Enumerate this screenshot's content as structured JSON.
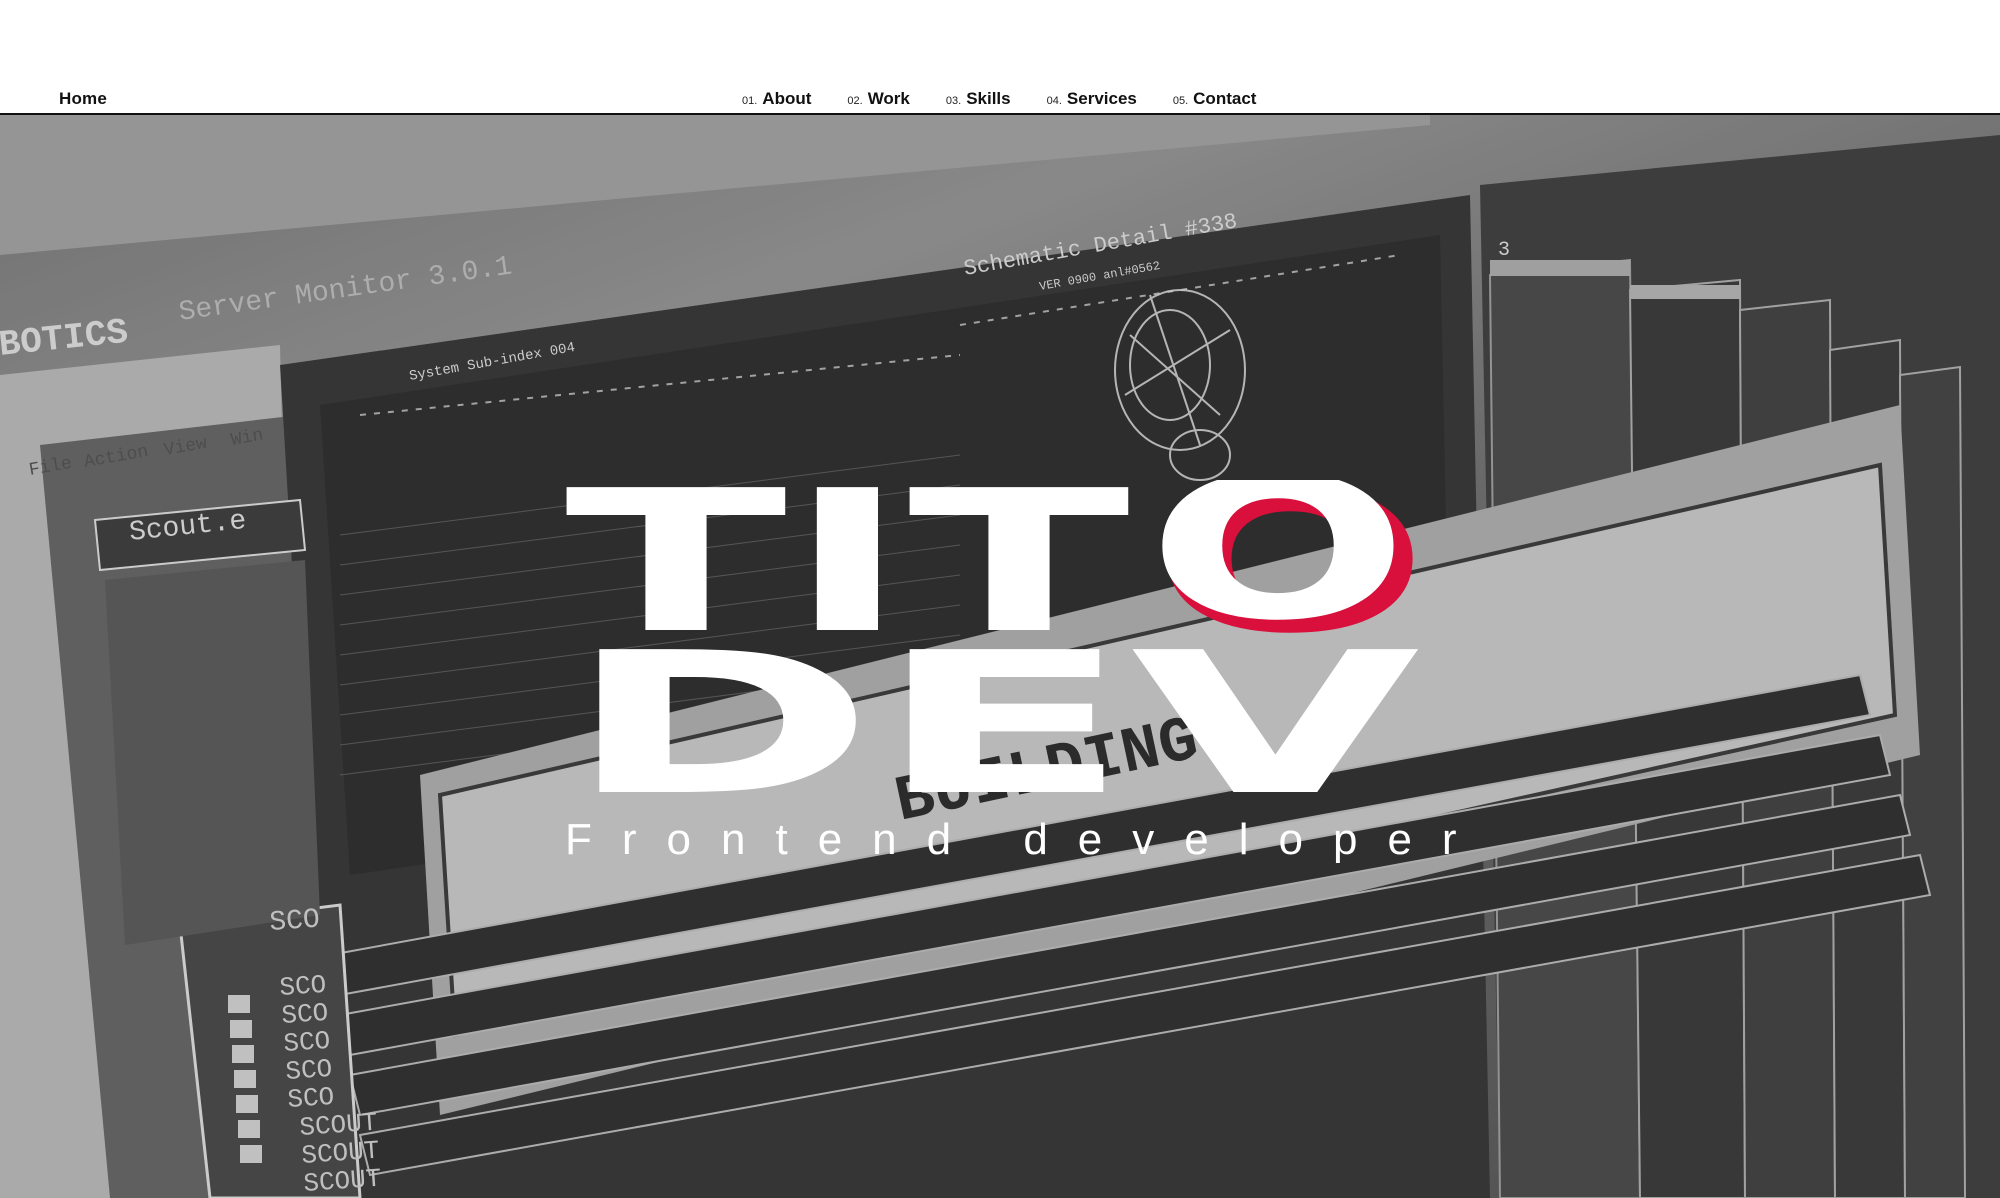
{
  "nav": {
    "home_label": "Home",
    "items": [
      {
        "num": "01.",
        "label": "About"
      },
      {
        "num": "02.",
        "label": "Work"
      },
      {
        "num": "03.",
        "label": "Skills"
      },
      {
        "num": "04.",
        "label": "Services"
      },
      {
        "num": "05.",
        "label": "Contact"
      }
    ]
  },
  "hero": {
    "title_line1": "TIT",
    "title_o": "O",
    "title_line2": "DEV",
    "subtitle": "Frontend developer",
    "accent_color": "#d8103b",
    "background_text": {
      "brand": "BOTICS",
      "monitor": "Server Monitor 3.0.1",
      "schematic": "Schematic Detail #338",
      "version": "VER 0900 anl#0562",
      "subsystem": "System Sub-index 004",
      "window": "Scout.e",
      "menu": [
        "File",
        "Action",
        "View",
        "Win"
      ],
      "building": "BUILDING..",
      "scout_rows": [
        "SCO",
        "SCO",
        "SCO",
        "SCO",
        "SCO",
        "SCOUT",
        "SCOUT",
        "SCOUT"
      ],
      "scout_header": "SCO",
      "number": "3"
    }
  }
}
